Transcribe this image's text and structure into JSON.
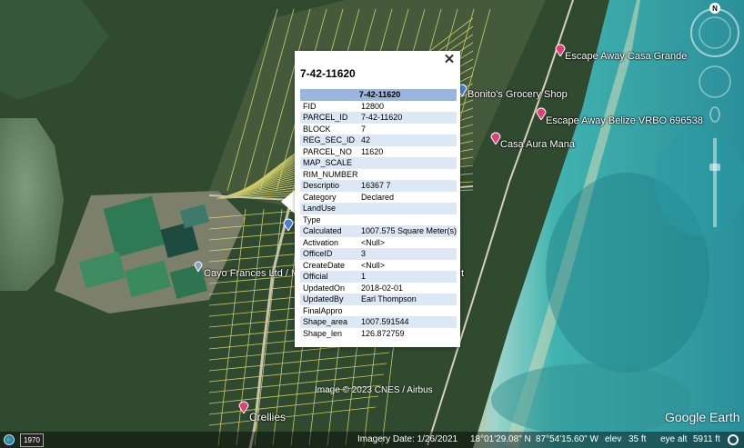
{
  "popup": {
    "title": "7-42-11620",
    "table_header": "7-42-11620",
    "rows": [
      {
        "key": "FID",
        "value": "12800"
      },
      {
        "key": "PARCEL_ID",
        "value": "7-42-11620"
      },
      {
        "key": "BLOCK",
        "value": "7"
      },
      {
        "key": "REG_SEC_ID",
        "value": "42"
      },
      {
        "key": "PARCEL_NO",
        "value": "11620"
      },
      {
        "key": "MAP_SCALE",
        "value": ""
      },
      {
        "key": "RIM_NUMBER",
        "value": ""
      },
      {
        "key": "Descriptio",
        "value": "16367 7"
      },
      {
        "key": "Category",
        "value": "Declared"
      },
      {
        "key": "LandUse",
        "value": ""
      },
      {
        "key": "Type",
        "value": ""
      },
      {
        "key": "Calculated",
        "value": "1007.575 Square Meter(s)"
      },
      {
        "key": "Activation",
        "value": "<Null>"
      },
      {
        "key": "OfficeID",
        "value": "3"
      },
      {
        "key": "CreateDate",
        "value": "<Null>"
      },
      {
        "key": "Official",
        "value": "1"
      },
      {
        "key": "UpdatedOn",
        "value": "2018-02-01"
      },
      {
        "key": "UpdatedBy",
        "value": "Earl Thompson"
      },
      {
        "key": "FinalAppro",
        "value": ""
      },
      {
        "key": "Shape_area",
        "value": "1007.591544"
      },
      {
        "key": "Shape_len",
        "value": "126.872759"
      }
    ]
  },
  "places": {
    "casa_grande": "Escape Away Casa Grande",
    "bonitos": "Bonito's Grocery Shop",
    "vrbo": "Escape Away Belize VRBO 696538",
    "casa_aura": "Casa Aura Mana",
    "cayo_frances": "Cayo Frances Ltd / M",
    "partial_t": "t",
    "crellies": "Crellies"
  },
  "copyright": "Image © 2023 CNES / Airbus",
  "brand": "Google Earth",
  "compass_north": "N",
  "status": {
    "year": "1970",
    "imagery_date": "Imagery Date: 1/26/2021",
    "lat": "18°01'29.08\" N",
    "lon": "87°54'15.60\" W",
    "elev_label": "elev",
    "elev_value": "35 ft",
    "eye_alt_label": "eye alt",
    "eye_alt_value": "5911 ft"
  },
  "colors": {
    "parcel_lines": "#e8e070",
    "water_deep": "#3aa6a8",
    "popup_header": "#9ab6dc",
    "popup_alt_row": "#dde8f5",
    "pin_pink": "#e0407a",
    "pin_blue": "#4a7fd8"
  },
  "icons": {
    "close": "close-icon",
    "pins": "map-pin-icon",
    "compass": "compass-icon",
    "globe": "globe-icon"
  }
}
